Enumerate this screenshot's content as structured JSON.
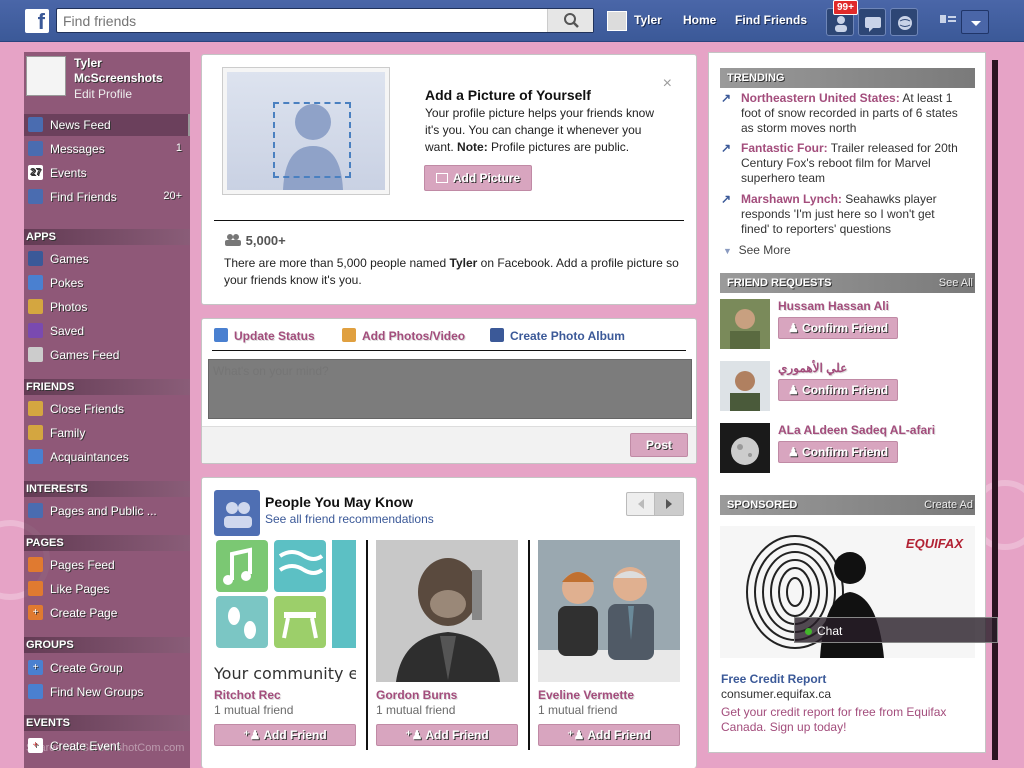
{
  "colors": {
    "accent": "#3b5998",
    "theme_pink": "#e6a3c6",
    "link": "#a34d7c"
  },
  "topbar": {
    "logo": "f",
    "search_placeholder": "Find friends",
    "user": "Tyler",
    "home": "Home",
    "find_friends": "Find Friends",
    "notif_badge": "99+"
  },
  "left": {
    "profile": {
      "name_line1": "Tyler",
      "name_line2": "McScreenshots",
      "edit": "Edit Profile"
    },
    "top_items": [
      {
        "label": "News Feed",
        "count": "",
        "icon": "news-feed-icon"
      },
      {
        "label": "Messages",
        "count": "1",
        "icon": "messages-icon"
      },
      {
        "label": "Events",
        "count": "",
        "icon": "events-icon"
      },
      {
        "label": "Find Friends",
        "count": "20+",
        "icon": "find-friends-icon"
      }
    ],
    "sections": {
      "apps": "APPS",
      "friends": "FRIENDS",
      "interests": "INTERESTS",
      "pages": "PAGES",
      "groups": "GROUPS",
      "events": "EVENTS"
    },
    "apps": [
      "Games",
      "Pokes",
      "Photos",
      "Saved",
      "Games Feed"
    ],
    "friends": [
      "Close Friends",
      "Family",
      "Acquaintances"
    ],
    "interests": [
      "Pages and Public ..."
    ],
    "pages": [
      "Pages Feed",
      "Like Pages",
      "Create Page"
    ],
    "groups": [
      "Create Group",
      "Find New Groups"
    ],
    "events": [
      "Create Event"
    ],
    "watermark": "Shared via ScreenshotCom.com"
  },
  "add_picture": {
    "title": "Add a Picture of Yourself",
    "desc": "Your profile picture helps your friends know it's you. You can change it whenever you want.",
    "note_label": "Note:",
    "note_text": "Profile pictures are public.",
    "button": "Add Picture",
    "count": "5,000+",
    "info_pre": "There are more than 5,000 people named",
    "info_name": "Tyler",
    "info_post": "on Facebook. Add a profile picture so your friends know it's you."
  },
  "composer": {
    "tab1": "Update Status",
    "tab2": "Add Photos/Video",
    "tab3": "Create Photo Album",
    "placeholder": "What's on your mind?",
    "post": "Post"
  },
  "pymk": {
    "title": "People You May Know",
    "subtitle": "See all friend recommendations",
    "people": [
      {
        "name": "Ritchot Rec",
        "mutual": "1 mutual friend",
        "button": "Add Friend",
        "caption": "Your community e"
      },
      {
        "name": "Gordon Burns",
        "mutual": "1 mutual friend",
        "button": "Add Friend"
      },
      {
        "name": "Eveline Vermette",
        "mutual": "1 mutual friend",
        "button": "Add Friend"
      }
    ]
  },
  "trending": {
    "header": "TRENDING",
    "items": [
      {
        "topic": "Northeastern United States:",
        "text": "At least 1 foot of snow recorded in parts of 6 states as storm moves north"
      },
      {
        "topic": "Fantastic Four:",
        "text": "Trailer released for 20th Century Fox's reboot film for Marvel superhero team"
      },
      {
        "topic": "Marshawn Lynch:",
        "text": "Seahawks player responds 'I'm just here so I won't get fined' to reporters' questions"
      }
    ],
    "see_more": "See More"
  },
  "friend_requests": {
    "header": "FRIEND REQUESTS",
    "see_all": "See All",
    "items": [
      {
        "name": "Hussam Hassan Ali",
        "button": "Confirm Friend"
      },
      {
        "name": "علي الأهموري",
        "button": "Confirm Friend"
      },
      {
        "name": "ALa ALdeen Sadeq AL-afari",
        "button": "Confirm Friend"
      }
    ]
  },
  "sponsored": {
    "header": "SPONSORED",
    "create_ad": "Create Ad",
    "brand": "EQUIFAX",
    "title": "Free Credit Report",
    "url": "consumer.equifax.ca",
    "desc": "Get your credit report for free from Equifax Canada. Sign up today!"
  },
  "chat": {
    "label": "Chat"
  }
}
